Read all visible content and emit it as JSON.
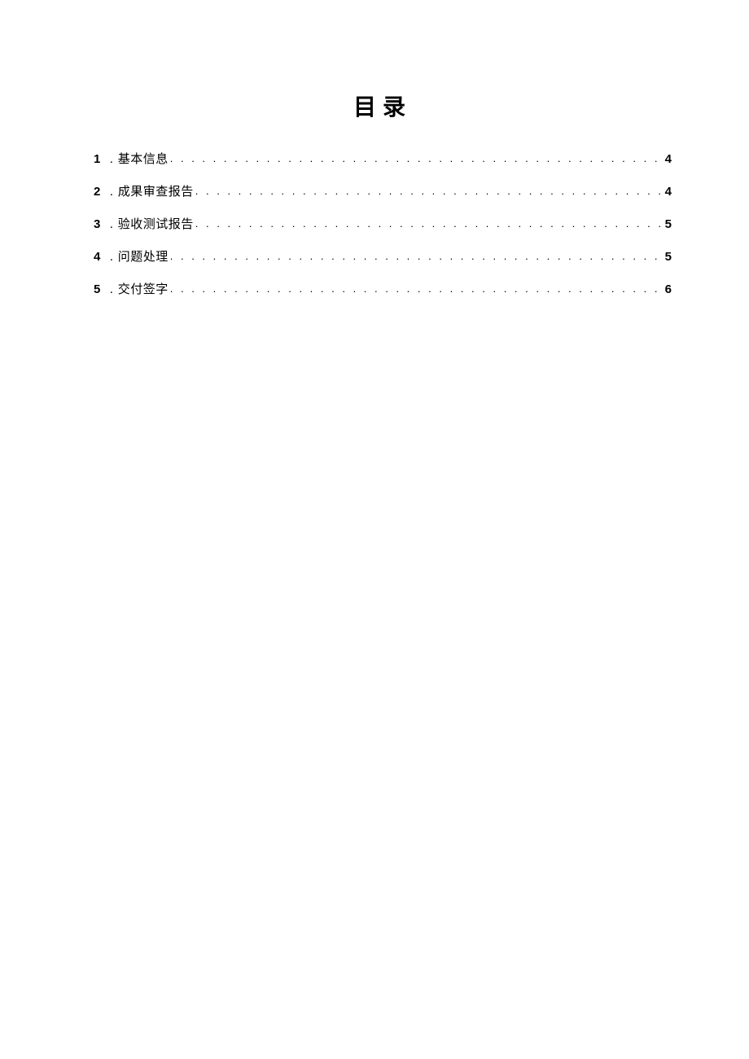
{
  "title": "目录",
  "entries": [
    {
      "num": "1",
      "label": "基本信息",
      "page": "4"
    },
    {
      "num": "2",
      "label": "成果审查报告",
      "page": "4"
    },
    {
      "num": "3",
      "label": "验收测试报告",
      "page": "5"
    },
    {
      "num": "4",
      "label": "问题处理",
      "page": "5"
    },
    {
      "num": "5",
      "label": "交付签字",
      "page": "6"
    }
  ]
}
